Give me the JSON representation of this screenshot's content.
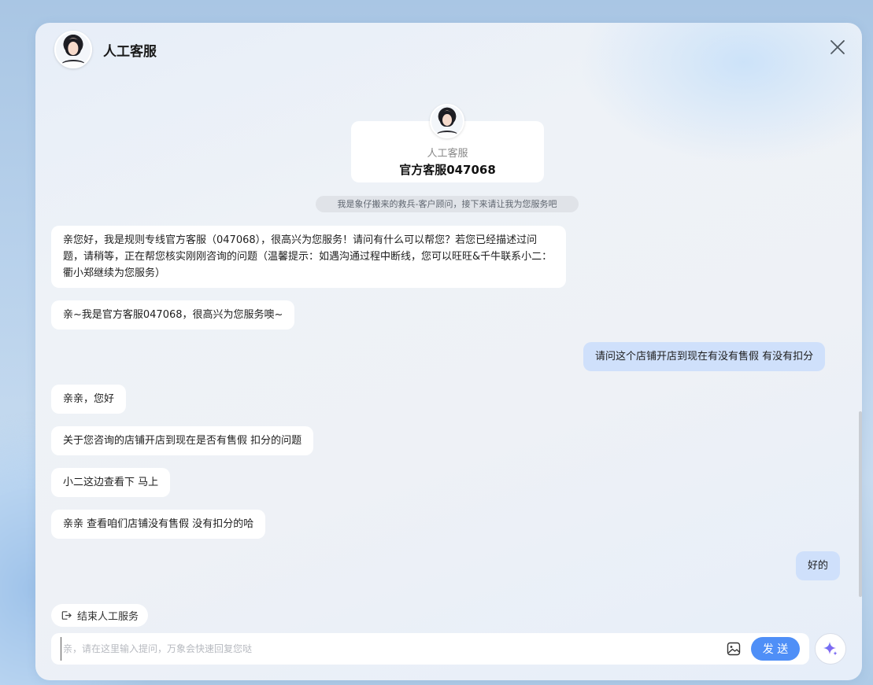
{
  "header": {
    "title": "人工客服"
  },
  "agent_card": {
    "role": "人工客服",
    "name": "官方客服047068"
  },
  "system_note": "我是象仔搬来的救兵-客户顾问，接下来请让我为您服务吧",
  "messages": [
    {
      "side": "left",
      "text": "亲您好，我是规则专线官方客服（047068），很高兴为您服务！请问有什么可以帮您？若您已经描述过问题，请稍等，正在帮您核实刚刚咨询的问题（温馨提示：如遇沟通过程中断线，您可以旺旺&千牛联系小二：衢小郑继续为您服务）"
    },
    {
      "side": "left",
      "text": "亲~我是官方客服047068，很高兴为您服务噢~"
    },
    {
      "side": "right",
      "text": "请问这个店铺开店到现在有没有售假 有没有扣分"
    },
    {
      "side": "left",
      "text": "亲亲，您好"
    },
    {
      "side": "left",
      "text": "关于您咨询的店铺开店到现在是否有售假 扣分的问题"
    },
    {
      "side": "left",
      "text": "小二这边查看下 马上"
    },
    {
      "side": "left",
      "text": "亲亲 查看咱们店铺没有售假 没有扣分的哈"
    },
    {
      "side": "right",
      "text": "好的"
    }
  ],
  "end_service": {
    "label": "结束人工服务"
  },
  "input": {
    "placeholder": "亲，请在这里输入提问，万象会快速回复您哒",
    "value": ""
  },
  "send_button": {
    "label": "发 送"
  },
  "colors": {
    "accent": "#4f8ff7",
    "user_bubble": "#cfe0fb",
    "agent_bubble": "#ffffff"
  }
}
